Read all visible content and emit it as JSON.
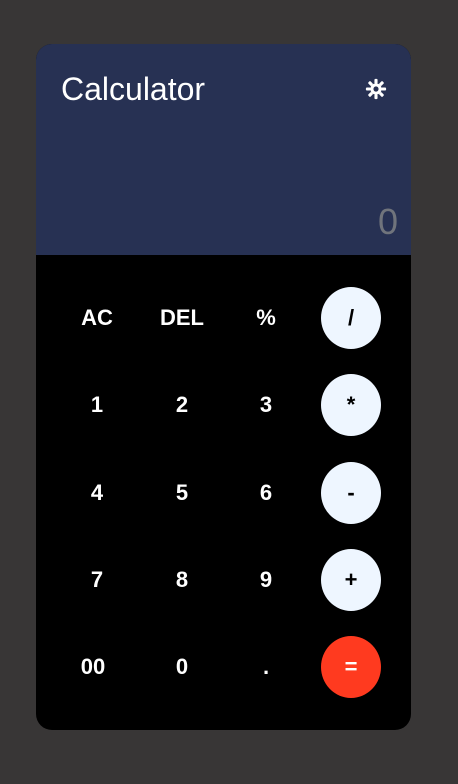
{
  "app": {
    "title": "Calculator",
    "theme_icon": "gear-icon"
  },
  "display": {
    "value": "0"
  },
  "keys": {
    "clear": "AC",
    "delete": "DEL",
    "percent": "%",
    "divide": "/",
    "one": "1",
    "two": "2",
    "three": "3",
    "multiply": "*",
    "four": "4",
    "five": "5",
    "six": "6",
    "subtract": "-",
    "seven": "7",
    "eight": "8",
    "nine": "9",
    "add": "+",
    "double_zero": "00",
    "zero": "0",
    "decimal": ".",
    "equals": "="
  },
  "colors": {
    "page_background": "#383636",
    "display_background": "#273153",
    "keypad_background": "#000000",
    "operator_key": "#eef6ff",
    "equals_key": "#ff3a1f",
    "result_text": "#70747c"
  }
}
